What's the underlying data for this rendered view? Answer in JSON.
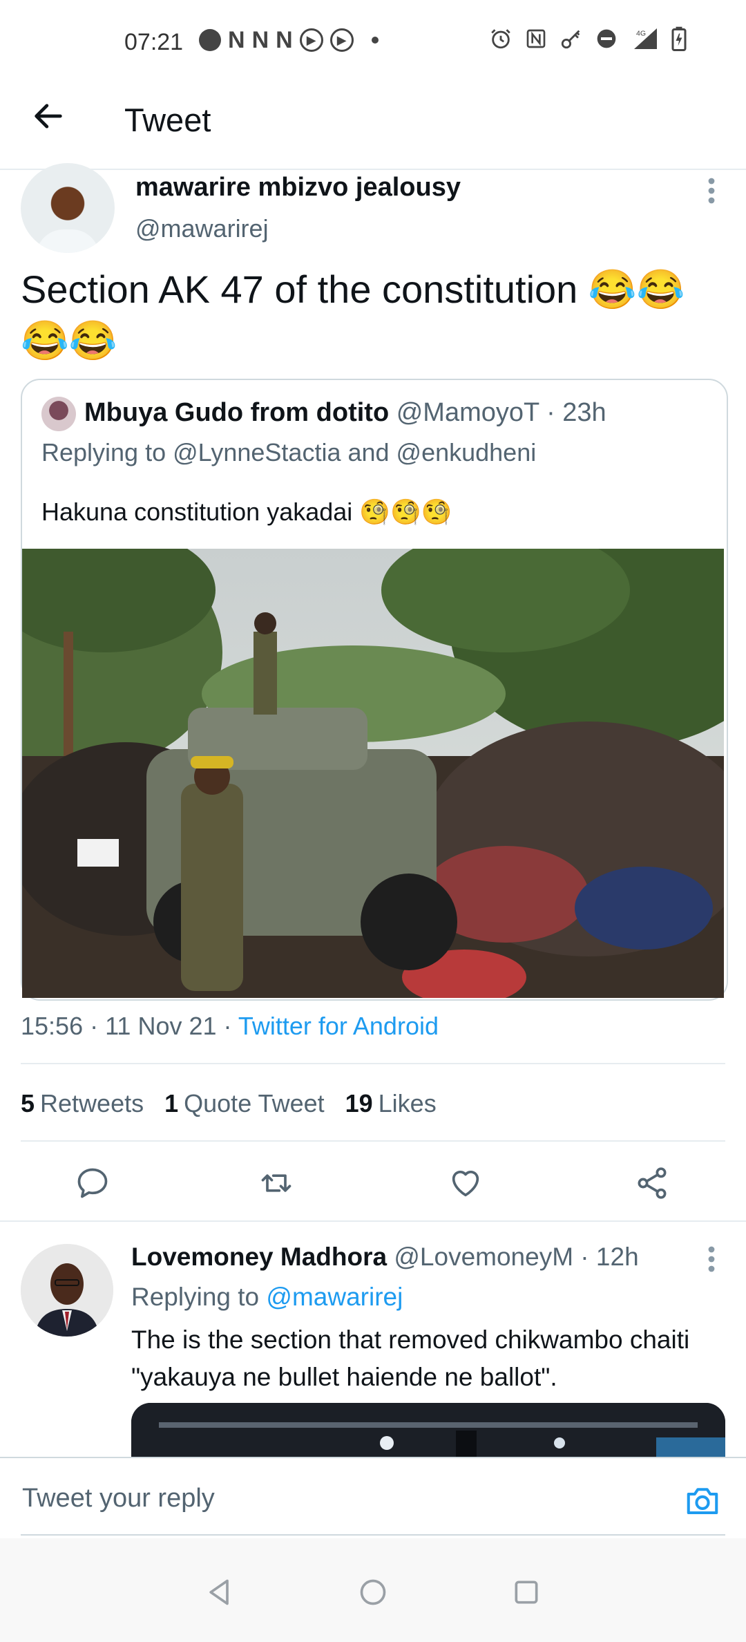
{
  "status_bar": {
    "time": "07:21",
    "left_icons": [
      "messenger-icon",
      "n-icon",
      "n-icon",
      "n-icon",
      "play-circle-icon",
      "play-circle-icon",
      "dot-icon"
    ],
    "right_icons": [
      "alarm-icon",
      "nfc-icon",
      "key-icon",
      "dnd-icon",
      "signal-4g-icon",
      "battery-charging-icon"
    ],
    "network": "4G"
  },
  "header": {
    "title": "Tweet",
    "back_icon": "arrow-left-icon"
  },
  "tweet": {
    "author_name": "mawarire mbizvo jealousy",
    "author_handle": "@mawarirej",
    "text": "Section AK 47 of the constitution 😂😂😂😂",
    "quoted": {
      "name": "Mbuya Gudo from dotito",
      "meta": " @MamoyoT · 23h",
      "replying_to": "Replying to @LynneStactia and @enkudheni",
      "text": "Hakuna constitution yakadai 🧐🧐🧐"
    },
    "timestamp": "15:56 · 11 Nov 21 · ",
    "source": "Twitter for Android",
    "stats": {
      "retweets_count": "5",
      "retweets_label": "Retweets",
      "quotes_count": "1",
      "quotes_label": "Quote Tweet",
      "likes_count": "19",
      "likes_label": "Likes"
    }
  },
  "reply": {
    "name": "Lovemoney Madhora",
    "meta": " @LovemoneyM · 12h",
    "replying_prefix": "Replying to ",
    "replying_mention": "@mawarirej",
    "text": "The is the section that removed chikwambo chaiti \"yakauya ne bullet haiende ne ballot\"."
  },
  "compose": {
    "placeholder": "Tweet your reply"
  },
  "colors": {
    "accent": "#1d9bf0",
    "text_primary": "#0f1419",
    "text_secondary": "#536471",
    "border": "#cfd9de"
  }
}
